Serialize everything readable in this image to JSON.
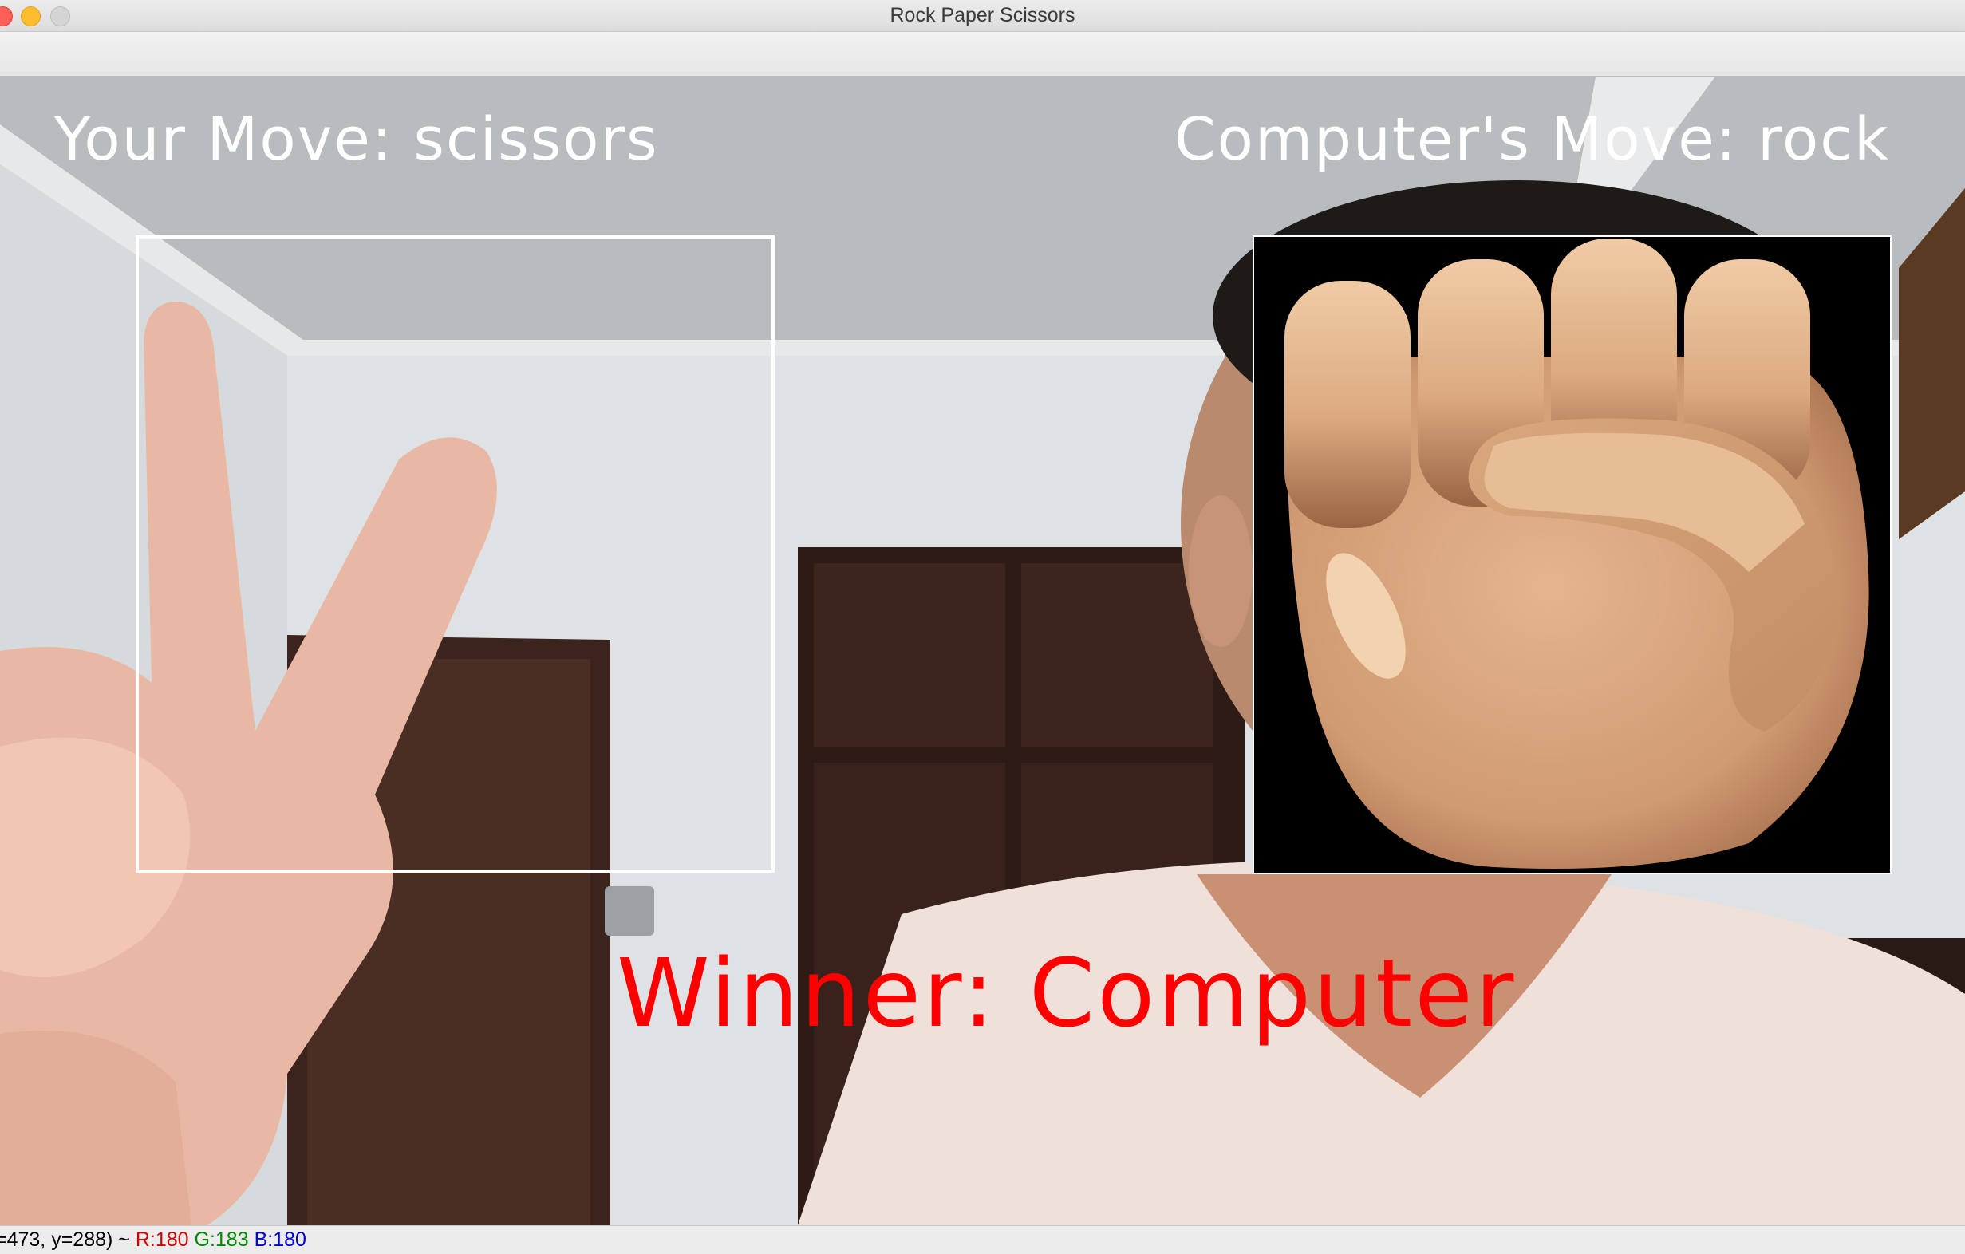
{
  "window": {
    "title": "Rock Paper Scissors"
  },
  "overlay": {
    "user_move": "Your Move: scissors",
    "computer_move": "Computer's Move: rock",
    "winner": "Winner: Computer"
  },
  "computer_move_image": {
    "icon": "raised-fist-emoji-icon"
  },
  "statusbar": {
    "position": "=473, y=288) ~",
    "r": "R:180",
    "g": "G:183",
    "b": "B:180"
  },
  "colors": {
    "winner_text": "#ff0000",
    "overlay_text": "#ffffff",
    "status_r": "#d40000",
    "status_g": "#008c00",
    "status_b": "#0000d8"
  }
}
